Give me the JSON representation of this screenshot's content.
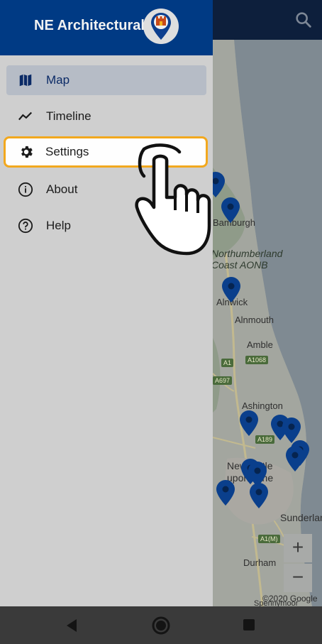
{
  "drawer": {
    "title": "NE Architectural",
    "items": [
      {
        "label": "Map",
        "icon": "map-icon",
        "active": true
      },
      {
        "label": "Timeline",
        "icon": "timeline-icon"
      },
      {
        "label": "Settings",
        "icon": "gear-icon",
        "highlighted": true
      },
      {
        "label": "About",
        "icon": "info-icon"
      },
      {
        "label": "Help",
        "icon": "help-icon"
      }
    ]
  },
  "map": {
    "labels": {
      "bamburgh": "Bamburgh",
      "aonb": "Northumberland Coast AONB",
      "alnwick": "Alnwick",
      "alnmouth": "Alnmouth",
      "amble": "Amble",
      "ashington": "Ashington",
      "newcastle": "Newcastle upon Tyne",
      "sunderland": "Sunderland",
      "durham": "Durham",
      "spennymoor": "Spennymoor"
    },
    "road_badges": [
      "A1",
      "A1068",
      "A697",
      "A189",
      "A1(M)"
    ],
    "zoom_in": "+",
    "zoom_out": "−",
    "copyright": "©2020 Google"
  },
  "colors": {
    "header": "#003a84",
    "app_bar": "#0d1f3c",
    "highlight_border": "#f2a81e",
    "active_item": "#b6bcc6",
    "pin": "#0a3f8c"
  }
}
